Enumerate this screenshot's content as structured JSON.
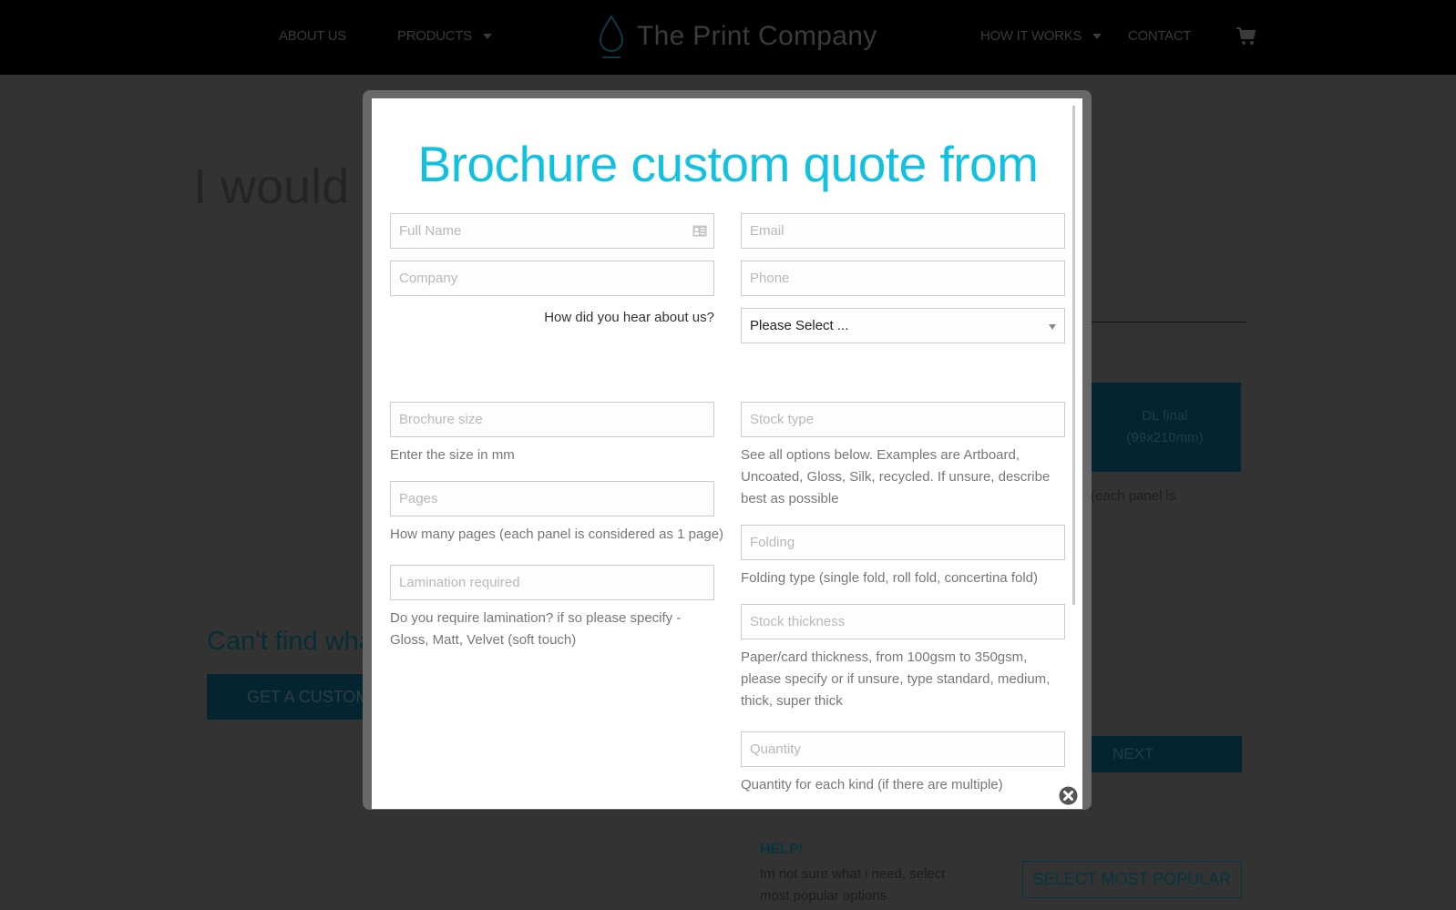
{
  "header": {
    "nav_left": [
      {
        "label": "ABOUT US",
        "has_dropdown": false
      },
      {
        "label": "PRODUCTS",
        "has_dropdown": true
      }
    ],
    "logo_text": "The Print Company",
    "logo_icon": "droplet-icon",
    "nav_right": [
      {
        "label": "HOW IT WORKS",
        "has_dropdown": true
      },
      {
        "label": "CONTACT",
        "has_dropdown": false
      }
    ],
    "cart_icon": "shopping-cart-icon"
  },
  "background_page": {
    "heading": "I would l",
    "tile": {
      "line1": "DL final",
      "line2": "(99x210mm)"
    },
    "panel_text": "(each panel is",
    "cant_find": "Can't find wha",
    "custom_button": "GET A CUSTOM",
    "next_button": "NEXT",
    "help_title": "HELP!",
    "help_text": "Im not sure what i need, select most popular options",
    "popular_button": "SELECT MOST POPULAR"
  },
  "modal": {
    "title": "Brochure custom quote from",
    "accent_color": "#12c1df",
    "fields": {
      "full_name": {
        "placeholder": "Full Name",
        "value": ""
      },
      "email": {
        "placeholder": "Email",
        "value": ""
      },
      "company": {
        "placeholder": "Company",
        "value": ""
      },
      "phone": {
        "placeholder": "Phone",
        "value": ""
      },
      "hear_about_label": "How did you hear about us?",
      "hear_about_select": {
        "selected": "Please Select ..."
      },
      "brochure_size": {
        "placeholder": "Brochure size",
        "value": "",
        "help": "Enter the size in mm"
      },
      "stock_type": {
        "placeholder": "Stock type",
        "value": "",
        "help": "See all options below. Examples are Artboard, Uncoated, Gloss, Silk, recycled. If unsure, describe best as possible"
      },
      "pages": {
        "placeholder": "Pages",
        "value": "",
        "help": "How many pages (each panel is considered as 1 page)"
      },
      "folding": {
        "placeholder": "Folding",
        "value": "",
        "help": "Folding type (single fold, roll fold, concertina fold)"
      },
      "lamination": {
        "placeholder": "Lamination required",
        "value": "",
        "help": "Do you require lamination? if so please specify - Gloss, Matt, Velvet (soft touch)"
      },
      "stock_thickness": {
        "placeholder": "Stock thickness",
        "value": "",
        "help": "Paper/card thickness, from 100gsm to 350gsm, please specify or if unsure, type standard, medium, thick, super thick"
      },
      "quantity": {
        "placeholder": "Quantity",
        "value": "",
        "help": "Quantity for each kind (if there are multiple)"
      }
    },
    "close_icon": "close-circle-icon"
  }
}
